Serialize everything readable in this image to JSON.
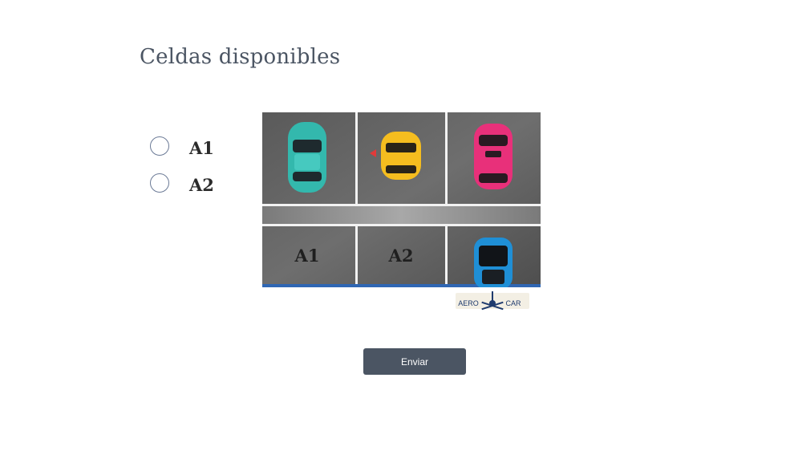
{
  "page": {
    "title": "Celdas disponibles"
  },
  "options": [
    {
      "label": "A1",
      "selected": false
    },
    {
      "label": "A2",
      "selected": false
    }
  ],
  "parking_image": {
    "slot_labels": [
      "A1",
      "A2"
    ],
    "car_colors": {
      "teal": "#33b8ad",
      "yellow": "#f5bd1f",
      "pink": "#e8307a",
      "blue": "#1f8fd6"
    }
  },
  "logo": {
    "left_text": "AERO",
    "right_text": "CAR"
  },
  "submit": {
    "label": "Enviar"
  },
  "colors": {
    "title": "#4b5563",
    "button_bg": "#4b5563",
    "button_text": "#ffffff",
    "radio_border": "#6b7a96"
  }
}
